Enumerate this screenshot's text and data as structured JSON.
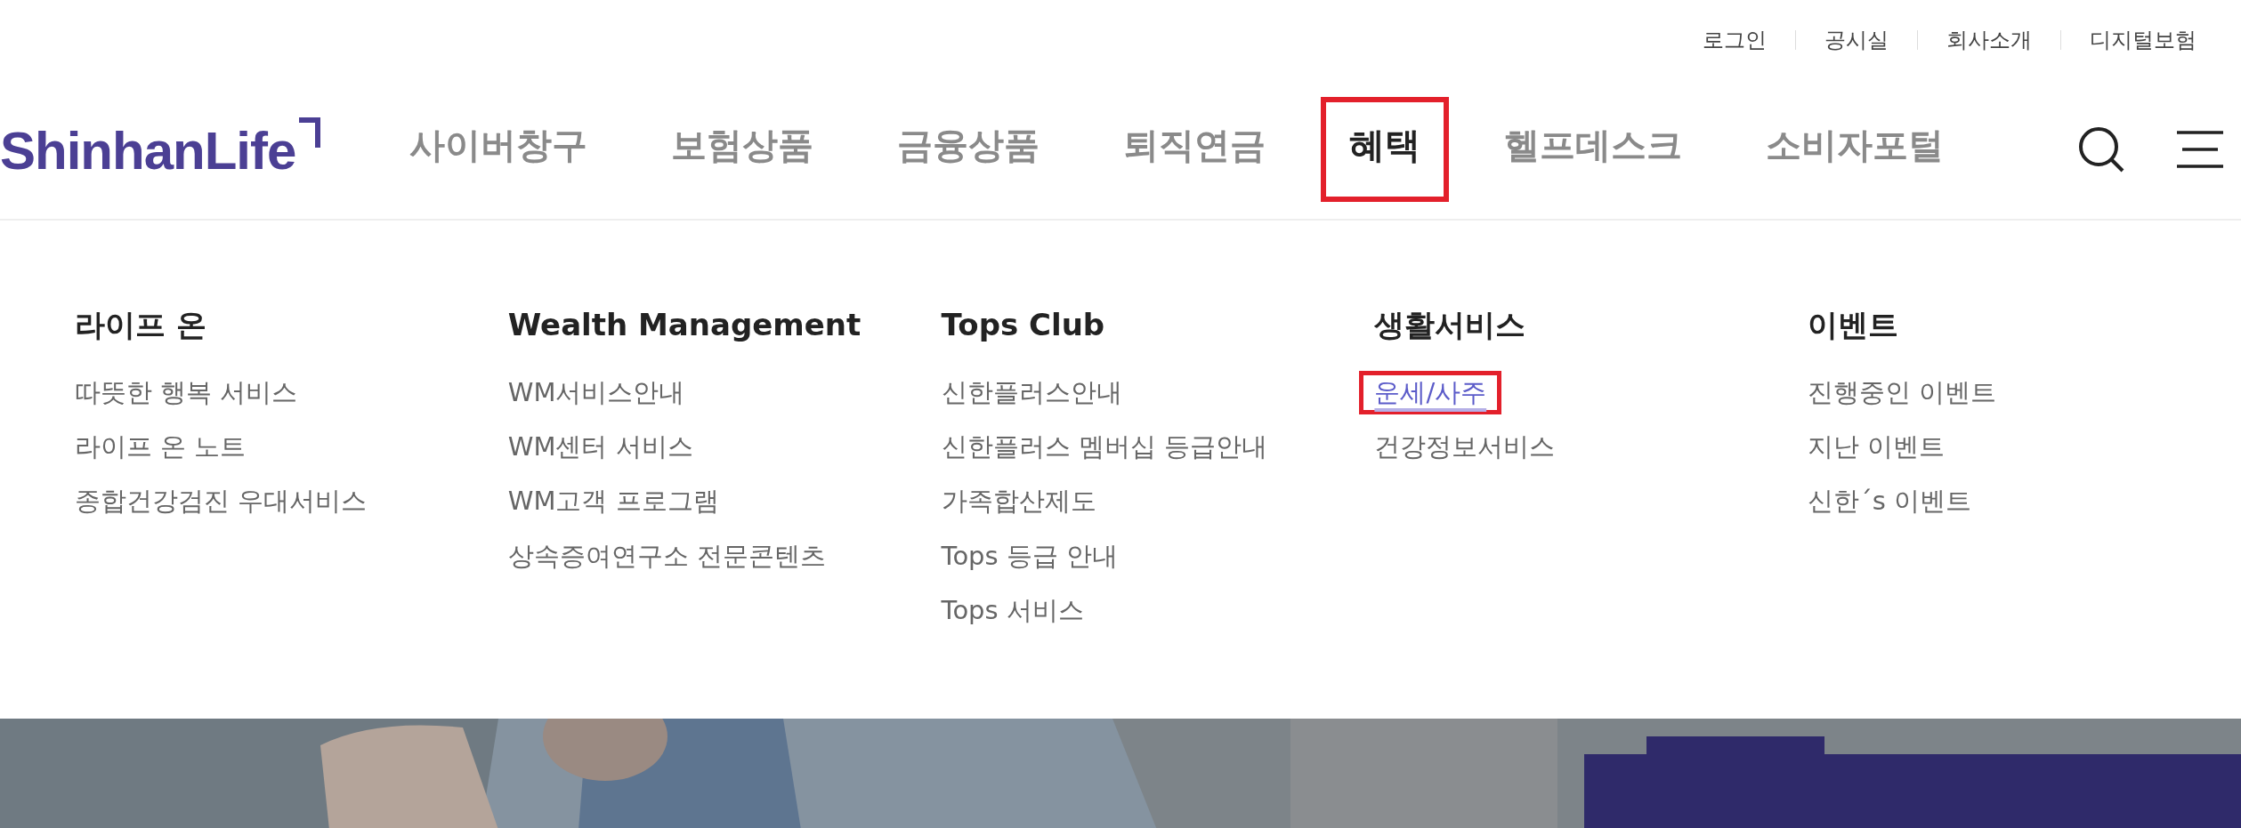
{
  "utility_links": [
    "로그인",
    "공시실",
    "회사소개",
    "디지털보험"
  ],
  "logo": "ShinhanLife",
  "nav": [
    {
      "label": "사이버창구",
      "selected": false,
      "highlighted": false
    },
    {
      "label": "보험상품",
      "selected": false,
      "highlighted": false
    },
    {
      "label": "금융상품",
      "selected": false,
      "highlighted": false
    },
    {
      "label": "퇴직연금",
      "selected": false,
      "highlighted": false
    },
    {
      "label": "혜택",
      "selected": true,
      "highlighted": true
    },
    {
      "label": "헬프데스크",
      "selected": false,
      "highlighted": false
    },
    {
      "label": "소비자포털",
      "selected": false,
      "highlighted": false
    }
  ],
  "menu_columns": [
    {
      "heading": "라이프 온",
      "links": [
        {
          "label": "따뜻한 행복 서비스",
          "hovered": false,
          "highlighted": false
        },
        {
          "label": "라이프 온 노트",
          "hovered": false,
          "highlighted": false
        },
        {
          "label": "종합건강검진 우대서비스",
          "hovered": false,
          "highlighted": false
        }
      ]
    },
    {
      "heading": "Wealth Management",
      "links": [
        {
          "label": "WM서비스안내",
          "hovered": false,
          "highlighted": false
        },
        {
          "label": "WM센터 서비스",
          "hovered": false,
          "highlighted": false
        },
        {
          "label": "WM고객 프로그램",
          "hovered": false,
          "highlighted": false
        },
        {
          "label": "상속증여연구소 전문콘텐츠",
          "hovered": false,
          "highlighted": false
        }
      ]
    },
    {
      "heading": "Tops Club",
      "links": [
        {
          "label": "신한플러스안내",
          "hovered": false,
          "highlighted": false
        },
        {
          "label": "신한플러스 멤버십 등급안내",
          "hovered": false,
          "highlighted": false
        },
        {
          "label": "가족합산제도",
          "hovered": false,
          "highlighted": false
        },
        {
          "label": "Tops 등급 안내",
          "hovered": false,
          "highlighted": false
        },
        {
          "label": "Tops 서비스",
          "hovered": false,
          "highlighted": false
        }
      ]
    },
    {
      "heading": "생활서비스",
      "links": [
        {
          "label": "운세/사주",
          "hovered": true,
          "highlighted": true
        },
        {
          "label": "건강정보서비스",
          "hovered": false,
          "highlighted": false
        }
      ]
    },
    {
      "heading": "이벤트",
      "links": [
        {
          "label": "진행중인 이벤트",
          "hovered": false,
          "highlighted": false
        },
        {
          "label": "지난 이벤트",
          "hovered": false,
          "highlighted": false
        },
        {
          "label": "신한´s 이벤트",
          "hovered": false,
          "highlighted": false
        }
      ]
    }
  ],
  "banner": {
    "kind": "picture"
  }
}
